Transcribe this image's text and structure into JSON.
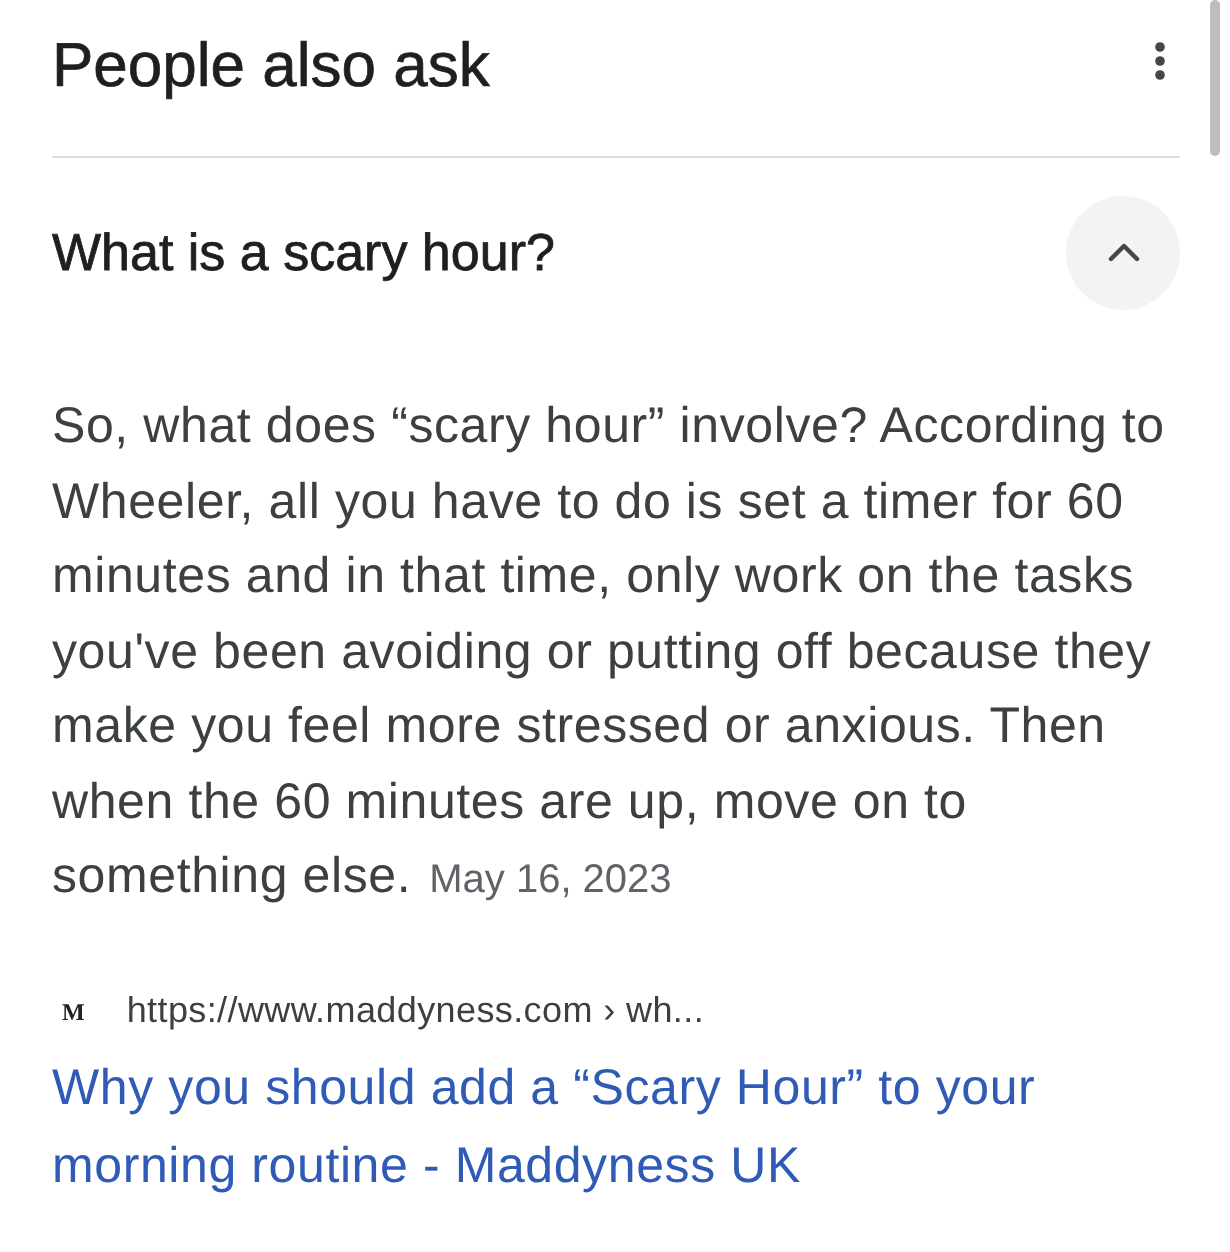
{
  "header": {
    "title": "People also ask"
  },
  "questions": [
    {
      "question": "What is a scary hour?",
      "expanded": true,
      "answer": "So, what does “scary hour” involve? According to Wheeler, all you have to do is set a timer for 60 minutes and in that time, only work on the tasks you've been avoiding or putting off because they make you feel more stressed or anxious. Then when the 60 minutes are up, move on to something else.",
      "date": "May 16, 2023",
      "source": {
        "site_logo": "M",
        "url": "https://www.maddyness.com › wh...",
        "title": "Why you should add a “Scary Hour” to your morning routine - Maddyness UK"
      }
    }
  ]
}
